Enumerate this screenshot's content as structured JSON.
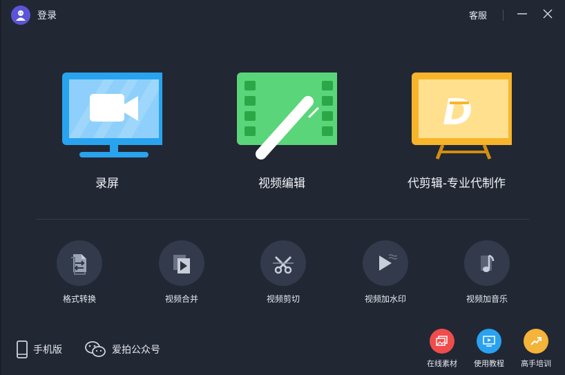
{
  "header": {
    "login_label": "登录",
    "support_label": "客服"
  },
  "features": [
    {
      "label": "录屏"
    },
    {
      "label": "视频编辑"
    },
    {
      "label": "代剪辑-专业代制作"
    }
  ],
  "tools": [
    {
      "label": "格式转换"
    },
    {
      "label": "视频合并"
    },
    {
      "label": "视频剪切"
    },
    {
      "label": "视频加水印"
    },
    {
      "label": "视频加音乐"
    }
  ],
  "footer_left": {
    "mobile_label": "手机版",
    "wechat_label": "爱拍公众号"
  },
  "footer_right": [
    {
      "label": "在线素材",
      "color": "#f04c4c"
    },
    {
      "label": "使用教程",
      "color": "#2aa2ef"
    },
    {
      "label": "高手培训",
      "color": "#f4b43a"
    }
  ],
  "colors": {
    "background": "#222734",
    "record_blue": "#29a3ee",
    "edit_green": "#4fcf6f",
    "agency_yellow": "#f7b52c"
  }
}
